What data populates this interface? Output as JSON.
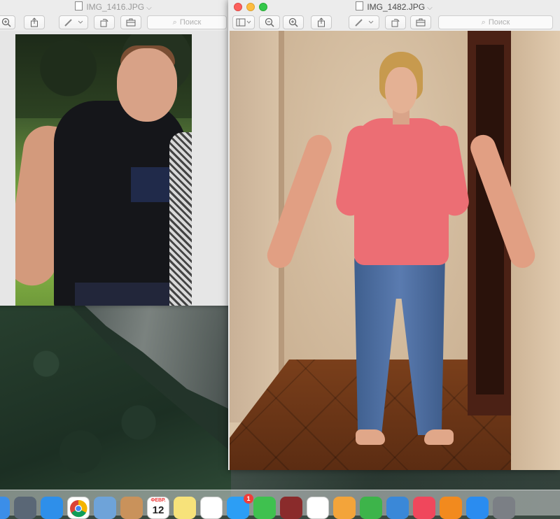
{
  "back_window": {
    "title": "IMG_1416.JPG",
    "search_placeholder": "Поиск",
    "toolbar": {
      "zoom_in_icon": "zoom-in-icon",
      "share_icon": "share-icon",
      "markup_icon": "pen-icon",
      "rotate_icon": "rotate-icon",
      "toolbox_icon": "toolbox-icon"
    }
  },
  "front_window": {
    "title": "IMG_1482.JPG",
    "search_placeholder": "Поиск",
    "toolbar": {
      "sidebar_icon": "sidebar-icon",
      "zoom_out_icon": "zoom-out-icon",
      "zoom_in_icon": "zoom-in-icon",
      "share_icon": "share-icon",
      "markup_icon": "pen-icon",
      "rotate_icon": "rotate-icon",
      "toolbox_icon": "toolbox-icon"
    }
  },
  "dock": {
    "items": [
      {
        "name": "finder",
        "color": "#3b8ee8"
      },
      {
        "name": "launchpad",
        "color": "#5a6776"
      },
      {
        "name": "safari",
        "color": "#2e8fea"
      },
      {
        "name": "chrome",
        "color": "#ffffff"
      },
      {
        "name": "preview",
        "color": "#6ea3d9"
      },
      {
        "name": "contacts",
        "color": "#c9925b"
      },
      {
        "name": "calendar",
        "color": "#ffffff"
      },
      {
        "name": "notes",
        "color": "#f7e27a"
      },
      {
        "name": "reminders",
        "color": "#ffffff"
      },
      {
        "name": "messages",
        "color": "#2c9ef5"
      },
      {
        "name": "facetime",
        "color": "#3fc14f"
      },
      {
        "name": "photo-booth",
        "color": "#8a2b2b"
      },
      {
        "name": "photos",
        "color": "#ffffff"
      },
      {
        "name": "pages",
        "color": "#f3a43a"
      },
      {
        "name": "numbers",
        "color": "#3db44a"
      },
      {
        "name": "keynote",
        "color": "#3a88d8"
      },
      {
        "name": "itunes",
        "color": "#f0475c"
      },
      {
        "name": "ibooks",
        "color": "#f28a1e"
      },
      {
        "name": "app-store",
        "color": "#2a8cf0"
      },
      {
        "name": "system-preferences",
        "color": "#7b7f85"
      }
    ],
    "calendar_month": "ФЕВР.",
    "calendar_day": "12",
    "messages_badge": "1"
  }
}
